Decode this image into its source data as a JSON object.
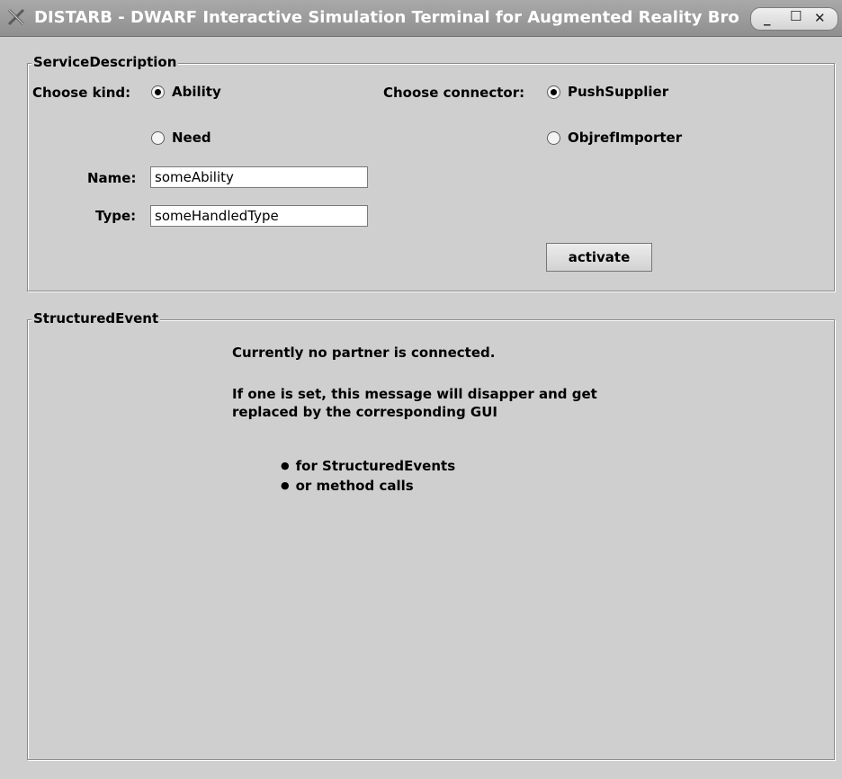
{
  "window": {
    "title": "DISTARB - DWARF Interactive Simulation Terminal for Augmented Reality Bro",
    "controls": {
      "minimize": "_",
      "maximize": "☐",
      "close": "✕"
    }
  },
  "service_description": {
    "title": "ServiceDescription",
    "kind_label": "Choose kind:",
    "kind_options": [
      {
        "label": "Ability",
        "selected": true
      },
      {
        "label": "Need",
        "selected": false
      }
    ],
    "connector_label": "Choose connector:",
    "connector_options": [
      {
        "label": "PushSupplier",
        "selected": true
      },
      {
        "label": "ObjrefImporter",
        "selected": false
      }
    ],
    "name_label": "Name:",
    "name_value": "someAbility",
    "type_label": "Type:",
    "type_value": "someHandledType",
    "activate_label": "activate"
  },
  "structured_event": {
    "title": "StructuredEvent",
    "line1": "Currently no partner is connected.",
    "line2": "If one is set, this message will disapper and get",
    "line3": "replaced by the corresponding GUI",
    "bullets": [
      "for StructuredEvents",
      "or method calls"
    ]
  }
}
